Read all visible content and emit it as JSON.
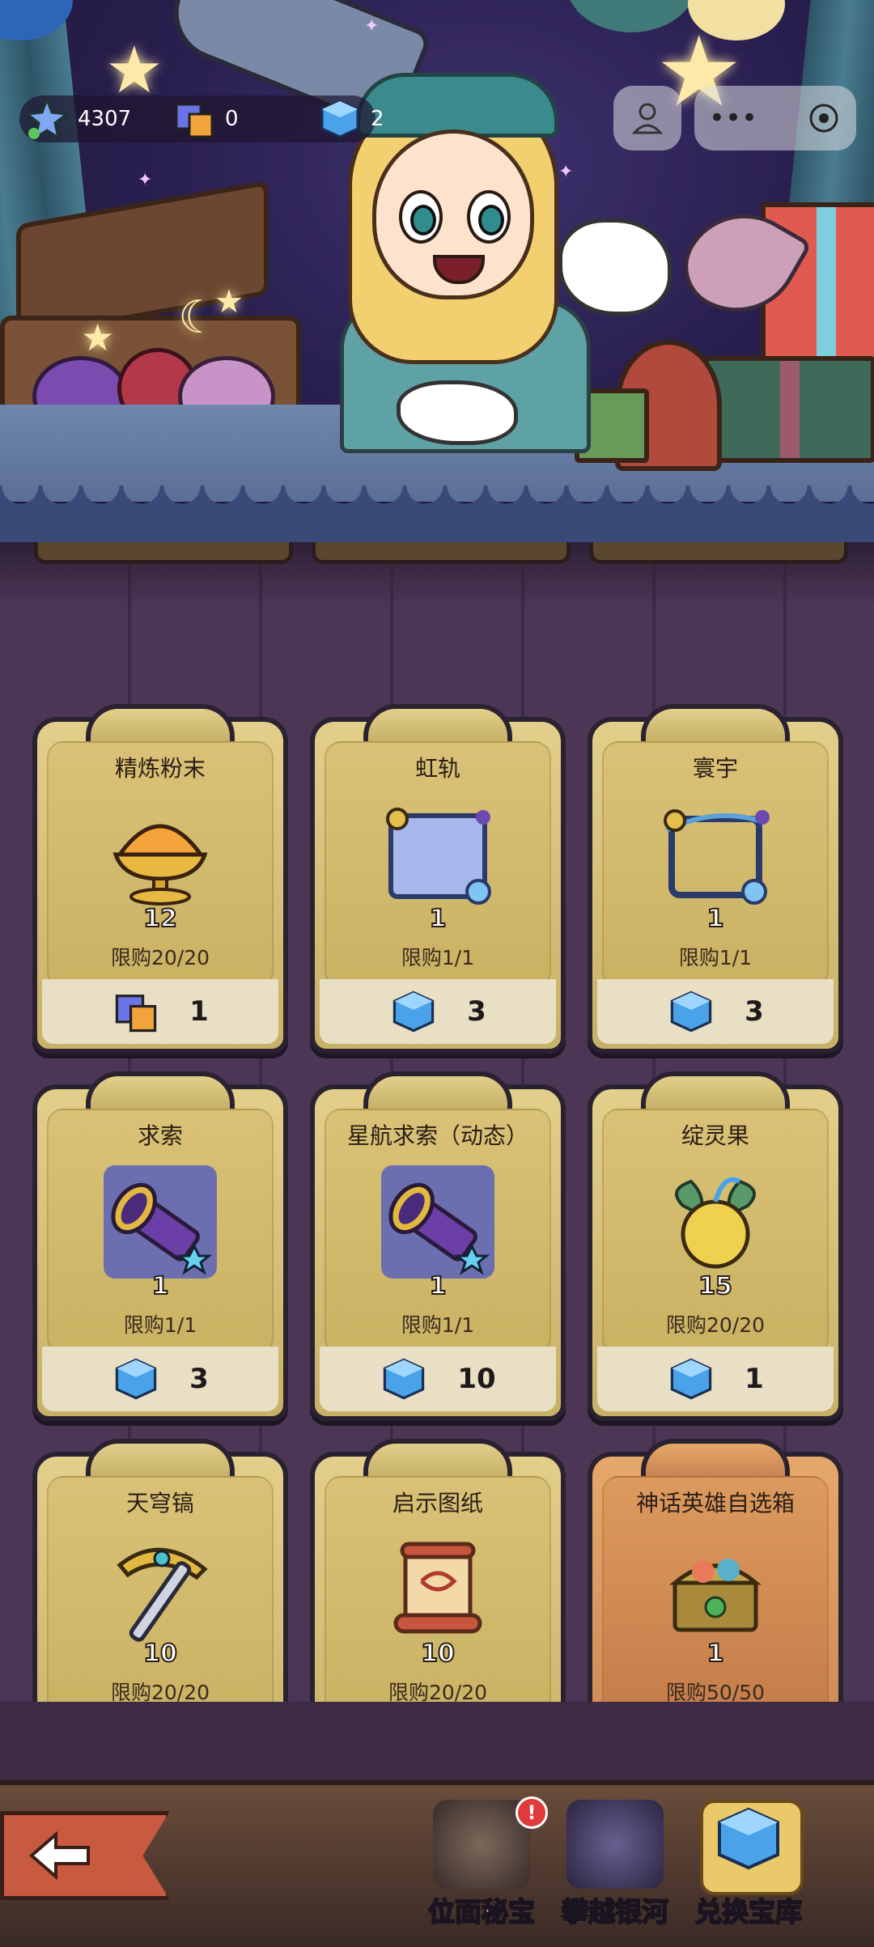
{
  "currencies": [
    {
      "name": "star-crystal",
      "value": "4307"
    },
    {
      "name": "purple-cube",
      "value": "0"
    },
    {
      "name": "blue-cube",
      "value": "2"
    }
  ],
  "shop": {
    "items": [
      {
        "title": "精炼粉末",
        "quantity": "12",
        "limit": "限购20/20",
        "price": "1",
        "currency_icon": "purple-cube-icon",
        "icon": "powder-bowl-icon"
      },
      {
        "title": "虹轨",
        "quantity": "1",
        "limit": "限购1/1",
        "price": "3",
        "currency_icon": "blue-cube-icon",
        "icon": "frame-icon"
      },
      {
        "title": "寰宇",
        "quantity": "1",
        "limit": "限购1/1",
        "price": "3",
        "currency_icon": "blue-cube-icon",
        "icon": "frame-icon"
      },
      {
        "title": "求索",
        "quantity": "1",
        "limit": "限购1/1",
        "price": "3",
        "currency_icon": "blue-cube-icon",
        "icon": "telescope-icon"
      },
      {
        "title": "星航求索（动态）",
        "quantity": "1",
        "limit": "限购1/1",
        "price": "10",
        "currency_icon": "blue-cube-icon",
        "icon": "telescope-icon"
      },
      {
        "title": "绽灵果",
        "quantity": "15",
        "limit": "限购20/20",
        "price": "1",
        "currency_icon": "blue-cube-icon",
        "icon": "fruit-icon"
      },
      {
        "title": "天穹镐",
        "quantity": "10",
        "limit": "限购20/20",
        "icon": "pickaxe-icon"
      },
      {
        "title": "启示图纸",
        "quantity": "10",
        "limit": "限购20/20",
        "icon": "scroll-icon"
      },
      {
        "title": "神话英雄自选箱",
        "quantity": "1",
        "limit": "限购50/50",
        "icon": "treasure-chest-icon"
      }
    ]
  },
  "nav": {
    "items": [
      {
        "label": "位面秘宝"
      },
      {
        "label": "攀越银河"
      },
      {
        "label": "兑换宝库"
      }
    ]
  },
  "colors": {
    "card": "#d9c277",
    "card_special": "#dc9a5e",
    "background": "#4c3656",
    "back_button": "#c75a3f"
  }
}
